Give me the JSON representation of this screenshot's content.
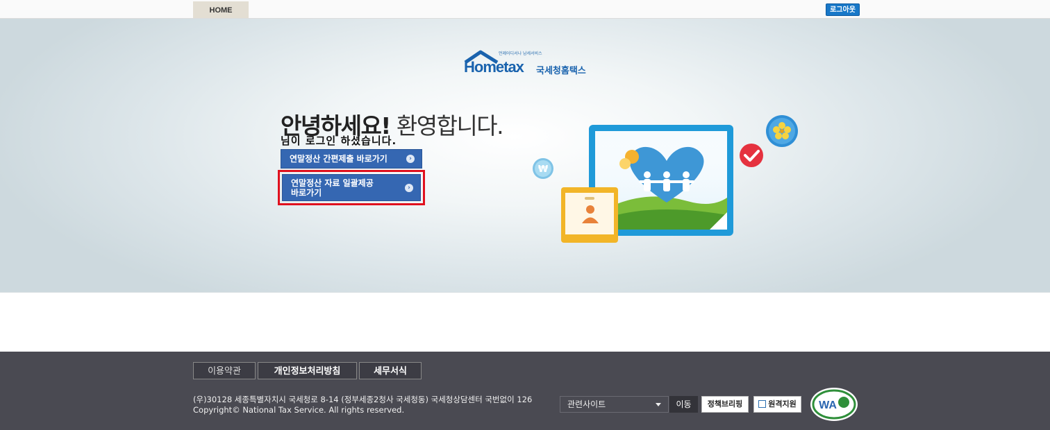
{
  "topbar": {
    "home_label": "HOME",
    "logout_label": "로그아웃"
  },
  "logo": {
    "small_text": "언제어디서나 납세서비스",
    "brand": "Hometax",
    "brand_korean": "국세청홈택스"
  },
  "greeting": {
    "strong": "안녕하세요!",
    "light": "환영합니다.",
    "sub": "님이 로그인 하셨습니다."
  },
  "buttons": {
    "simple_submit": "연말정산 간편제출 바로가기",
    "bulk_provide_line1": "연말정산 자료 일괄제공",
    "bulk_provide_line2": "바로가기"
  },
  "footer": {
    "tabs": [
      "이용약관",
      "개인정보처리방침",
      "세무서식"
    ],
    "address": "(우)30128 세종특별자치시 국세청로 8-14 (정부세종2청사 국세청동) 국세청상담센터 국번없이 126",
    "copyright": "Copyright© National Tax Service. All rights reserved.",
    "related_sites": "관련사이트",
    "go": "이동",
    "policy_briefing": "정책브리핑",
    "remote_support": "원격지원",
    "wa_label": "WA"
  },
  "colors": {
    "accent": "#1a63ae",
    "button": "#3567b2",
    "highlight": "#e0111e",
    "footer_bg": "#4a4a52"
  }
}
